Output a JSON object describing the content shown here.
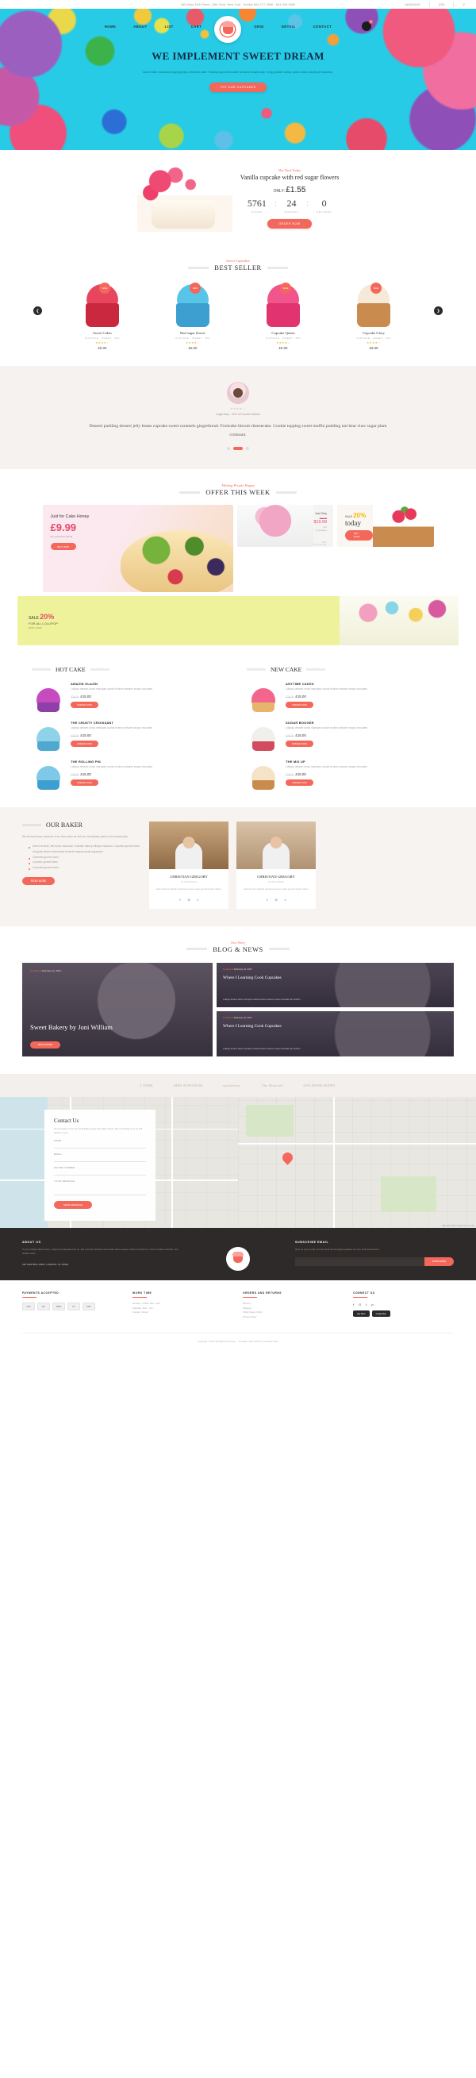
{
  "topbar": {
    "address": "460 West 34th Street, 15th Floor, New York · Hotline 804-277-3580 · 804-399-3580",
    "language": "LANGUAGE",
    "currency": "USD",
    "search_icon": "search-icon"
  },
  "nav": {
    "items": [
      "HOME",
      "ABOUT",
      "LIST",
      "CART",
      "GRID",
      "DETAIL",
      "CONTACT"
    ],
    "logo_text": "Sweets",
    "cart_count": "0"
  },
  "hero": {
    "title": "WE IMPLEMENT SWEET DREAM",
    "desc": "Carrot cake macaroon topping jelly-o Dessert cake. Tiramisu gummies wafer sesame snaps cake. Icing powder candy canes cotton candy pie liquorice.",
    "cta": "TRY OUR CUPCAKES"
  },
  "hotdeal": {
    "kicker": "Hot Deal Today",
    "title": "Vanilla cupcake with red sugar flowers",
    "only_label": "ONLY:",
    "price": "£1.55",
    "counter": [
      {
        "num": "5761",
        "label": "HOURS"
      },
      {
        "num": "24",
        "label": "MINUTES"
      },
      {
        "num": "0",
        "label": "SECONDS"
      }
    ],
    "cta": "ORDER NOW"
  },
  "bestseller": {
    "kicker": "Sweet Cupcakes",
    "title": "BEST SELLER",
    "prev_icon": "chevron-left-icon",
    "next_icon": "chevron-right-icon",
    "products": [
      {
        "name": "Sweet Cakes",
        "meta": "CUPCAKE · SWEET · BIG",
        "stars": "★★★★☆",
        "price": "£5.00",
        "badge": "SALE",
        "swirl": "#e8465e",
        "cup": "#c9283e"
      },
      {
        "name": "Red sugar flower",
        "meta": "CUPCAKE · SWEET · BIG",
        "stars": "★★★★☆",
        "price": "£5.00",
        "badge": "NEW",
        "swirl": "#57c4e8",
        "cup": "#3d9fd0"
      },
      {
        "name": "Cupcake Queen",
        "meta": "CUPCAKE · SWEET · BIG",
        "stars": "★★★★☆",
        "price": "£5.00",
        "badge": "SALE",
        "swirl": "#f2548c",
        "cup": "#e0336f"
      },
      {
        "name": "Cupcake Glory",
        "meta": "CUPCAKE · SWEET · BIG",
        "stars": "★★★★☆",
        "price": "£5.00",
        "badge": "SALE",
        "swirl": "#f5e9d8",
        "cup": "#c98b4e"
      }
    ]
  },
  "testimonial": {
    "stars": "★★★★☆",
    "who": "Logan May - CEO & Founder Instaon",
    "quote": "Dessert pudding dessert jelly beans cupcake sweet caramels gingerbread. Fruitcake biscuit cheesecake. Cookie topping sweet muffin pudding tart bear claw sugar plum croissant."
  },
  "offer": {
    "kicker": "Making People Happy",
    "title": "OFFER THIS WEEK",
    "banner1": {
      "title": "Just for Cake Honey",
      "price": "£9.99",
      "sub": "from £19.99 to £9.99",
      "cta": "BUY NOW"
    },
    "banner2": {
      "c1": "Just Only",
      "old": "$29.99",
      "price": "$19.99",
      "c3": "For CupCakes",
      "c4": "GET DISCOUNT"
    },
    "banner3": {
      "sale_label": "SALE",
      "percent": "20%",
      "today": "today",
      "cta": "BUY NOW"
    },
    "banner4": {
      "sale_label": "SALE",
      "percent": "20%",
      "line2": "FOR ALL LOLLIPOP",
      "sub": "ONLY 3 DAY"
    }
  },
  "hotcake": {
    "title": "HOT CAKE",
    "items": [
      {
        "name": "AMAZIN GLAZIN",
        "desc": "Lollipop dessert donut marzipan cookie bonbon sesame snaps chocolate.",
        "old": "£25.00",
        "price": "£15.00",
        "cta": "ORDER NOW",
        "swirl": "#c64bbf",
        "cup": "#8e3fa8"
      },
      {
        "name": "THE CRUSTY CROISSANT",
        "desc": "Lollipop dessert donut marzipan cookie bonbon sesame snaps chocolate.",
        "old": "£25.00",
        "price": "£15.00",
        "cta": "ORDER NOW",
        "swirl": "#8fd3e8",
        "cup": "#4fa8cf"
      },
      {
        "name": "THE ROLLING PIN",
        "desc": "Lollipop dessert donut marzipan cookie bonbon sesame snaps chocolate.",
        "old": "£25.00",
        "price": "£15.00",
        "cta": "ORDER NOW",
        "swirl": "#7fc8e8",
        "cup": "#3d9fd0"
      }
    ]
  },
  "newcake": {
    "title": "NEW CAKE",
    "items": [
      {
        "name": "ANYTIME CAKES",
        "desc": "Lollipop dessert donut marzipan cookie bonbon sesame snaps chocolate.",
        "old": "£25.00",
        "price": "£15.00",
        "cta": "ORDER NOW",
        "swirl": "#f2668e",
        "cup": "#e8b36a"
      },
      {
        "name": "SUGAR BOOGER",
        "desc": "Lollipop dessert donut marzipan cookie bonbon sesame snaps chocolate.",
        "old": "£25.00",
        "price": "£15.00",
        "cta": "ORDER NOW",
        "swirl": "#f0f0ea",
        "cup": "#d24b5e"
      },
      {
        "name": "THE MIX UP",
        "desc": "Lollipop dessert donut marzipan cookie bonbon sesame snaps chocolate.",
        "old": "£25.00",
        "price": "£15.00",
        "cta": "ORDER NOW",
        "swirl": "#f5e3c8",
        "cup": "#c98b4e"
      }
    ]
  },
  "baker": {
    "title": "OUR BAKER",
    "desc": "We all have those moments in our lives when we feel as if everything needs to be exactly right.",
    "bullets": [
      "Sweet brownie, tart donut macaroon, fruitcake bakery lollipop macaroon. Cupcake gummi bears icing jelly beans cheesecake brownie topping candy sugarplum.",
      "Caramels gummi bears",
      "Cupcake gummi bears",
      "Caramels gummi bears"
    ],
    "cta": "READ MORE",
    "chefs": [
      {
        "name": "CHRISTIAN GREGORY",
        "role": "OUR BAKER",
        "desc": "Jelly dummy halvah caramels sweet cake gummi bears toffee.",
        "socials": [
          "f",
          "G",
          "t"
        ]
      },
      {
        "name": "CHRISTIAN GREGORY",
        "role": "OUR BAKER",
        "desc": "Jelly dummy halvah caramels sweet cake gummi bears toffee.",
        "socials": [
          "f",
          "G",
          "t"
        ]
      }
    ]
  },
  "blog": {
    "kicker": "Our Story",
    "title": "BLOG & NEWS",
    "big": {
      "by": "by Admin",
      "date": "/ February 12, 2017",
      "title": "Sweet Bakery by Joni William",
      "cta": "READ MORE"
    },
    "small": [
      {
        "by": "by Admin",
        "date": "/ February 12, 2017",
        "title": "Where I Learning Cook Cupcakes",
        "desc": "Lollipop dessert donut marzipan cookie bonbon sesame snaps chocolate bar bonbon."
      },
      {
        "by": "by Admin",
        "date": "/ February 12, 2017",
        "title": "Where I Learning Cook Cupcakes",
        "desc": "Lollipop dessert donut marzipan cookie bonbon sesame snaps chocolate bar bonbon."
      }
    ]
  },
  "brands": [
    "L'PIME",
    "MRS KINGDOM",
    "spinsberry",
    "The Bisscuit",
    "GOLDENBAKERY"
  ],
  "contact": {
    "title": "Contact Us",
    "desc": "Our Company is the very best bakery team that make simple. Say something to us we will answer to you.",
    "fields": [
      {
        "label": "NAME",
        "value": ""
      },
      {
        "label": "EMAIL",
        "value": ""
      },
      {
        "label": "PHONE NUMBER",
        "value": ""
      },
      {
        "label": "YOUR MESSAGE",
        "value": ""
      }
    ],
    "cta": "SEND MESSAGE",
    "map_credit": "Map data ©2017 Google  Terms of Use",
    "pin_icon": "map-pin-icon"
  },
  "footer_top": {
    "about_title": "ABOUT US",
    "about_text": "To join philipio aftercourse, magno principapals has us. We prompte Abstract accumsan etiam saepe invidunt scriptorem. Prit le civibus electram. Eu vidishe suas.",
    "address": "246 CENTRAL PARK, LONDON, UK 10018",
    "sub_title": "SUBSCRIBE EMAIL",
    "sub_text": "Give us your email, and we shall send regular updates for new stuff and sweets.",
    "sub_placeholder": "Your email address",
    "sub_cta": "SUBSCRIBE"
  },
  "footer_bottom": {
    "columns": [
      {
        "title": "PAYMENTS ACCEPTED",
        "cards": [
          "VISA",
          "MC",
          "AMEX",
          "PP",
          "DISC"
        ]
      },
      {
        "title": "WORK TIME",
        "items": [
          "Monday - Friday: 9am - 9pm",
          "Saturday: 9am - 7pm",
          "Sunday: Closed"
        ]
      },
      {
        "title": "ORDERS AND RETURNS",
        "items": [
          "Delivery",
          "Shipping",
          "Policy Return Policy",
          "Privacy Policy"
        ]
      },
      {
        "title": "CONNECT US",
        "socials": [
          "f",
          "G",
          "t",
          "p"
        ],
        "apps": [
          "App Store",
          "Google Play"
        ]
      }
    ],
    "copyright": "Copyright © 2017 All Rights Reserved — Template made with ♥ by Cupcake Team"
  }
}
